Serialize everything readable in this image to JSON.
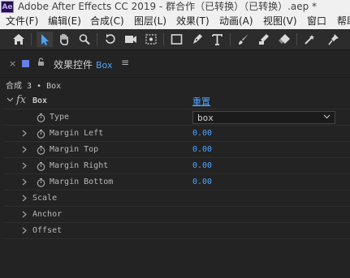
{
  "app": {
    "logo": "Ae",
    "title": "Adobe After Effects CC 2019 - 群合作（已转换）（已转换）.aep *"
  },
  "menu": [
    "文件(F)",
    "编辑(E)",
    "合成(C)",
    "图层(L)",
    "效果(T)",
    "动画(A)",
    "视图(V)",
    "窗口",
    "帮助"
  ],
  "toolbar": {
    "tools": [
      "home-icon",
      "selection-arrow-icon",
      "hand-icon",
      "zoom-icon",
      "rotate-icon",
      "camera-icon",
      "pan-behind-icon",
      "rectangle-icon",
      "pen-icon",
      "type-icon",
      "brush-icon",
      "clone-stamp-icon",
      "eraser-icon",
      "roto-brush-icon",
      "puppet-pin-icon"
    ],
    "selected": "selection-arrow-icon"
  },
  "panel": {
    "close": "×",
    "lock": "🔓",
    "title": "效果控件",
    "layer": "Box",
    "menu": "≡",
    "breadcrumb": "合成 3 • Box"
  },
  "effect": {
    "name": "Box",
    "fx": "fx",
    "reset": "重置",
    "properties": {
      "type": {
        "label": "Type",
        "value": "box"
      },
      "margin_left": {
        "label": "Margin Left",
        "value": "0.00"
      },
      "margin_top": {
        "label": "Margin Top",
        "value": "0.00"
      },
      "margin_right": {
        "label": "Margin Right",
        "value": "0.00"
      },
      "margin_bottom": {
        "label": "Margin Bottom",
        "value": "0.00"
      }
    },
    "groups": {
      "scale": "Scale",
      "anchor": "Anchor",
      "offset": "Offset"
    }
  },
  "colors": {
    "accent": "#4aa3ff",
    "layer_color": "#6a7de6",
    "panel_bg": "#232323"
  }
}
